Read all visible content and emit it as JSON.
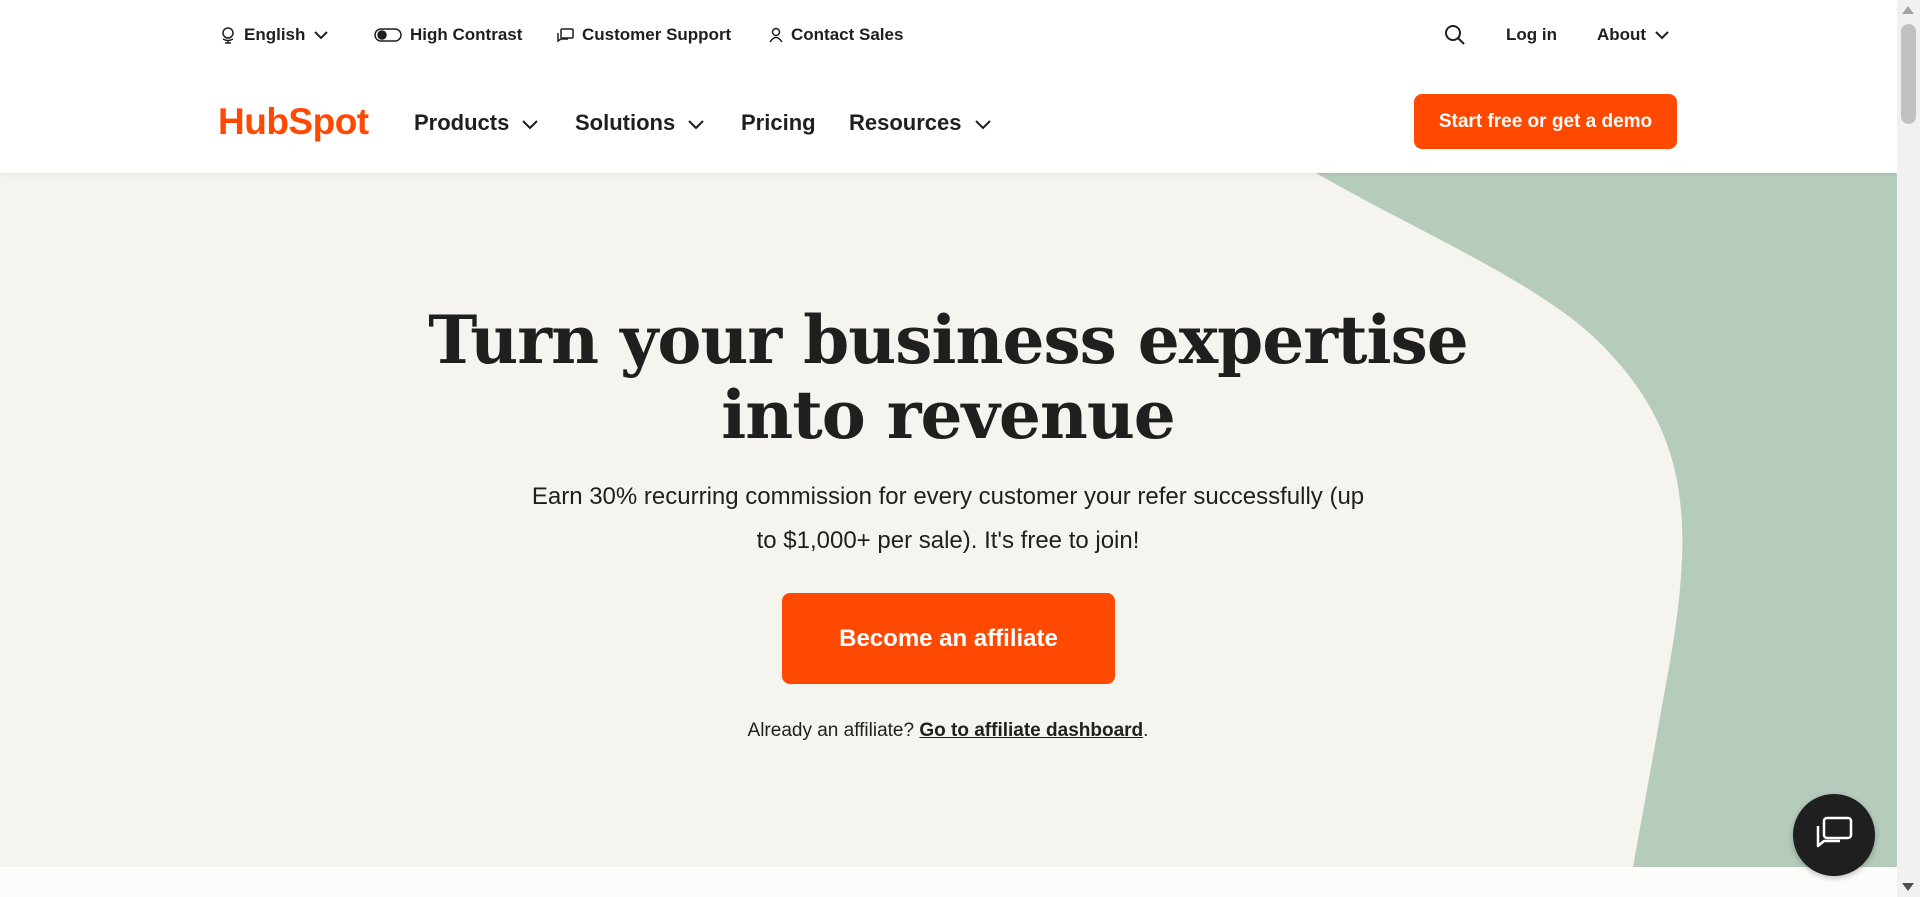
{
  "utility": {
    "language": "English",
    "high_contrast": "High Contrast",
    "customer_support": "Customer Support",
    "contact_sales": "Contact Sales",
    "login": "Log in",
    "about": "About"
  },
  "nav": {
    "logo": "HubSpot",
    "products": "Products",
    "solutions": "Solutions",
    "pricing": "Pricing",
    "resources": "Resources",
    "cta": "Start free or get a demo"
  },
  "hero": {
    "title_line1": "Turn your business expertise",
    "title_line2": "into revenue",
    "subtitle_line1": "Earn 30% recurring commission for every customer your refer successfully (up",
    "subtitle_line2": "to $1,000+ per sale). It's free to join!",
    "cta": "Become an affiliate",
    "already_text": "Already an affiliate?",
    "dashboard_link": "Go to affiliate dashboard",
    "period": "."
  },
  "colors": {
    "brand": "#ff4800",
    "hero_bg": "#f6f4ee",
    "hero_accent": "#b5cbbb",
    "text": "#1f1f1f"
  },
  "icons": [
    "globe-icon",
    "contrast-toggle-icon",
    "chat-bubbles-icon",
    "person-icon",
    "search-icon",
    "chevron-down-icon",
    "chat-launcher-icon"
  ]
}
